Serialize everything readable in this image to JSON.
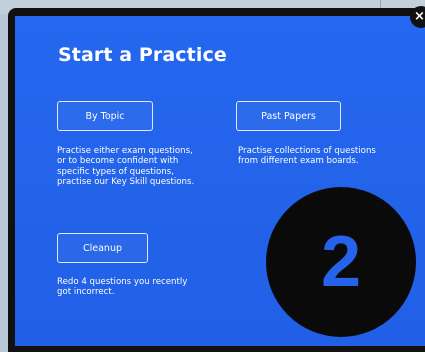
{
  "modal": {
    "title": "Start a Practice",
    "close_glyph": "×",
    "options": [
      {
        "label": "By Topic",
        "description": "Practise either exam questions,\nor to become confident with\nspecific types of questions,\npractise our Key Skill questions."
      },
      {
        "label": "Past Papers",
        "description": "Practise collections of questions\nfrom different exam boards."
      },
      {
        "label": "Cleanup",
        "description": "Redo 4 questions you recently\ngot incorrect."
      }
    ]
  },
  "overlay": {
    "step_number": "2"
  },
  "colors": {
    "modal_background": "#2463ea",
    "badge_background": "#0a0a0a",
    "text": "#ffffff"
  }
}
